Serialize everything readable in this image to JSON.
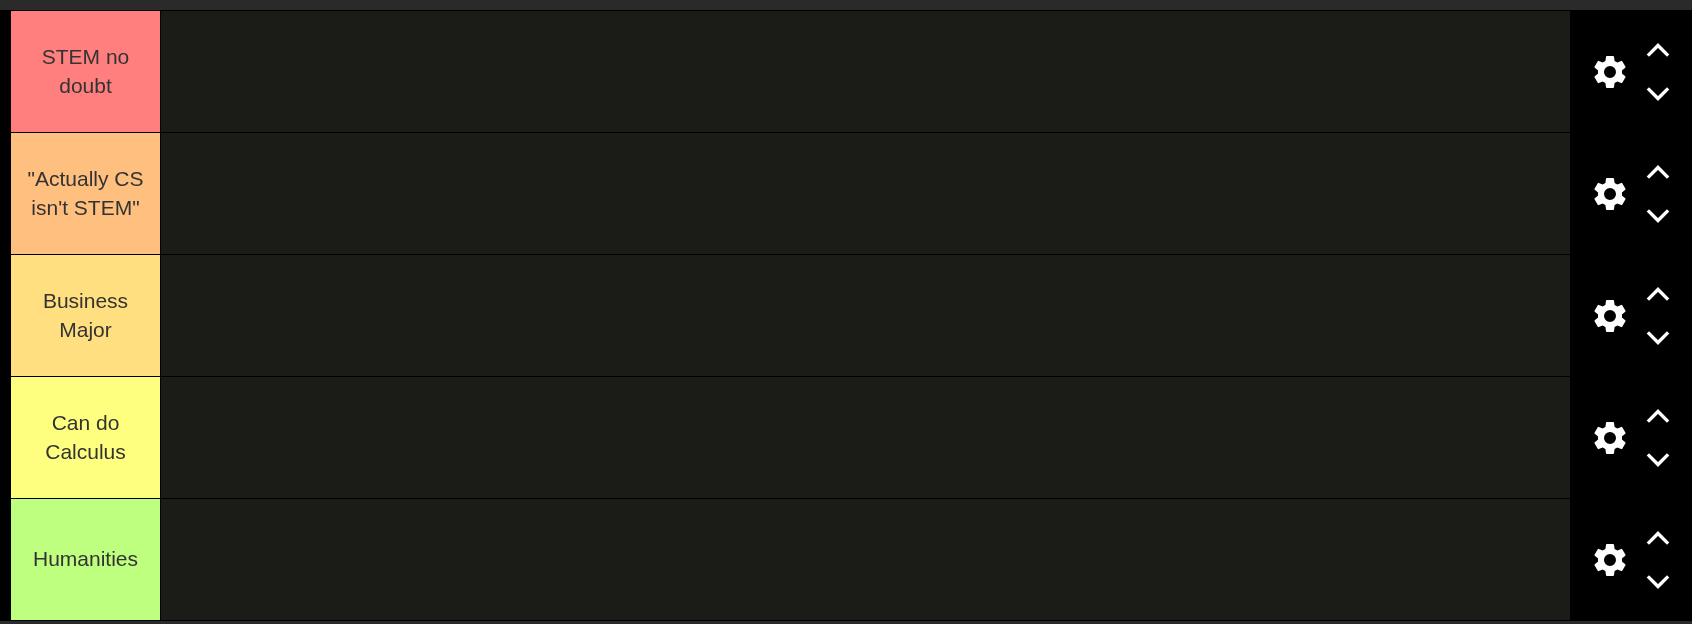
{
  "tiers": [
    {
      "label": "STEM no doubt",
      "color": "#ff7f7f"
    },
    {
      "label": "\"Actually CS isn't STEM\"",
      "color": "#ffbf7f"
    },
    {
      "label": "Business Major",
      "color": "#ffdf7f"
    },
    {
      "label": "Can do Calculus",
      "color": "#ffff7f"
    },
    {
      "label": "Humanities",
      "color": "#bfff7f"
    }
  ]
}
